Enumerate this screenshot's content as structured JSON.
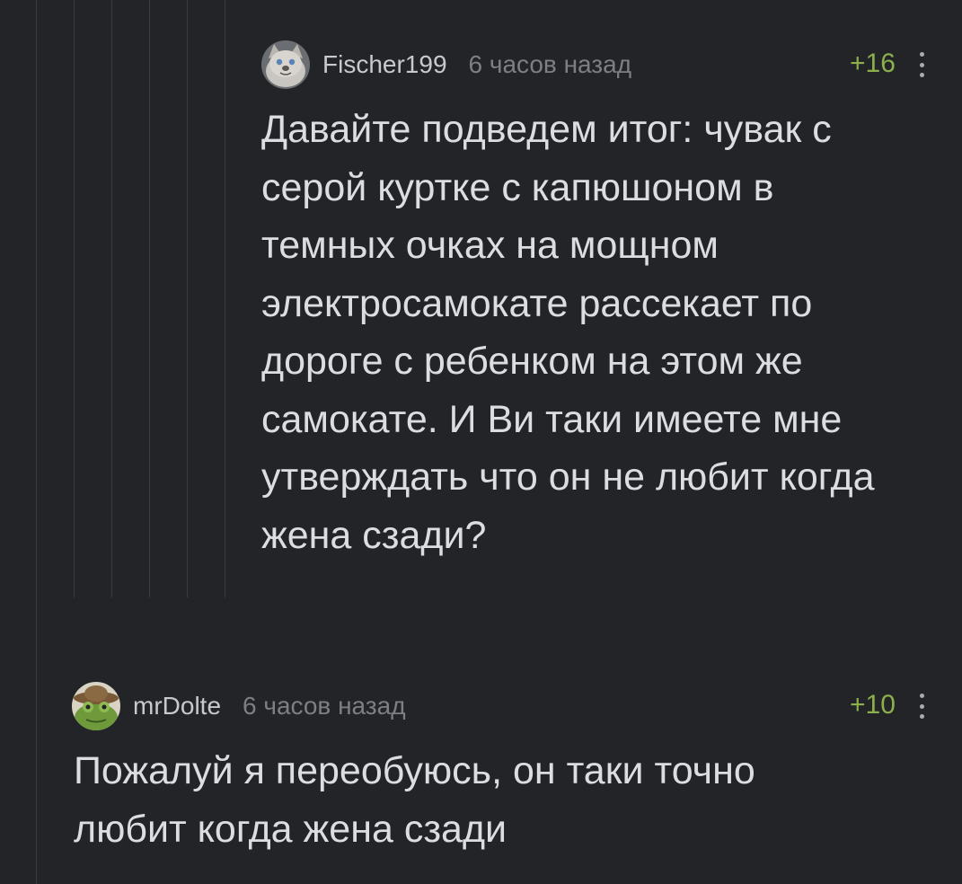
{
  "comments": [
    {
      "author": "Fischer199",
      "time": "6 часов назад",
      "rating": "+16",
      "avatar_icon": "cat-avatar-icon",
      "text_lines": [
        "Давайте подведем итог: чувак с",
        "серой куртке с капюшоном в",
        "темных очках на мощном",
        "электросамокате рассекает по",
        "дороге с ребенком на этом же",
        "самокате. И Ви таки имеете мне",
        "утверждать что он не любит когда",
        "жена сзади?"
      ]
    },
    {
      "author": "mrDolte",
      "time": "6 часов назад",
      "rating": "+10",
      "avatar_icon": "frog-cowboy-avatar-icon",
      "text_lines": [
        "Пожалуй я переобуюсь, он таки точно",
        "любит когда жена сзади"
      ]
    }
  ],
  "colors": {
    "background": "#232427",
    "rating": "#8bb04c",
    "thread_line": "#3a3b3f"
  },
  "icons": {
    "more": "kebab-menu-icon"
  }
}
